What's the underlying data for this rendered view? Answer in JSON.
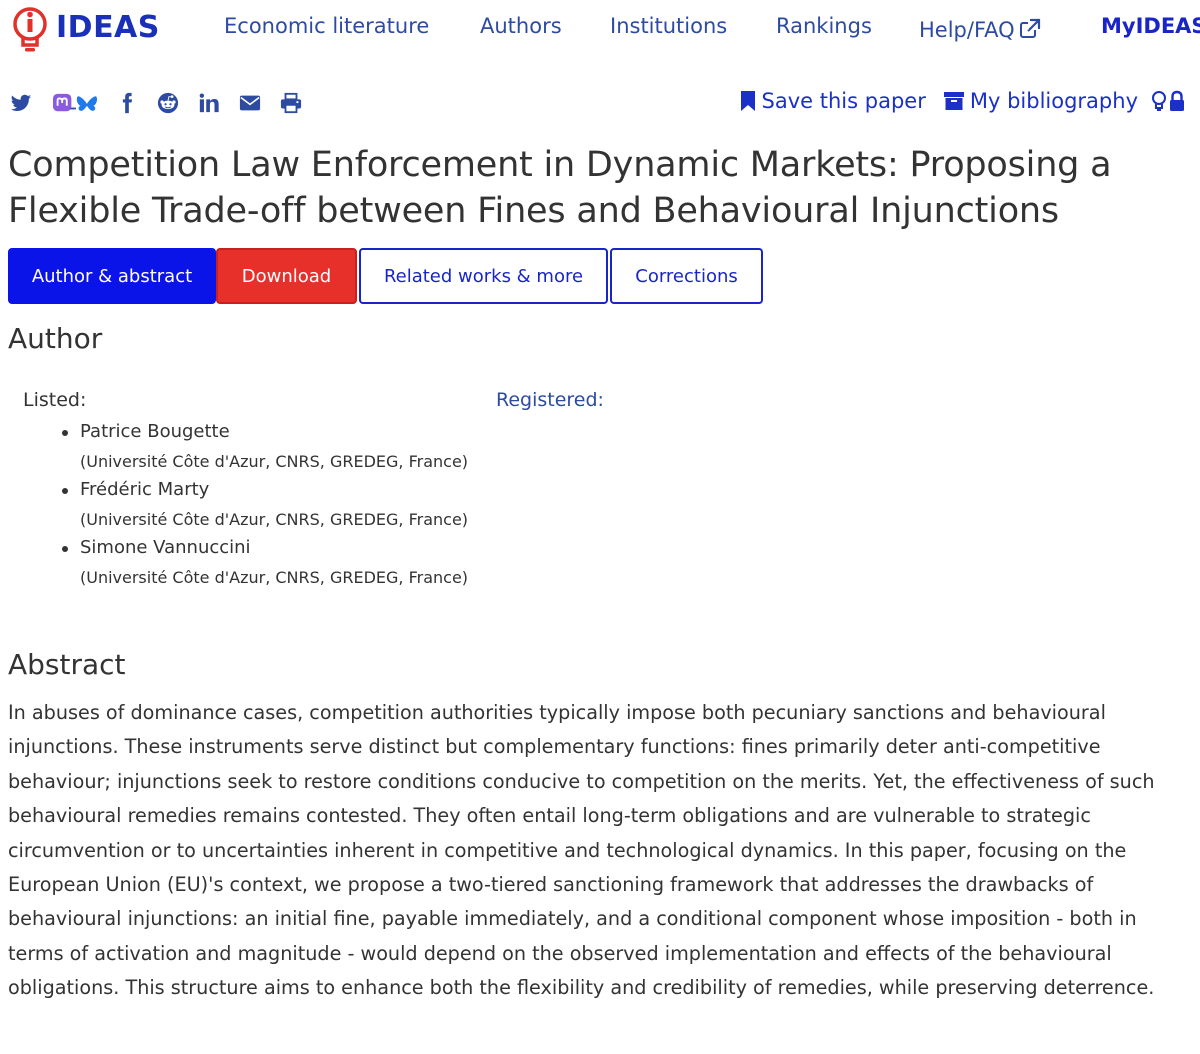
{
  "site": {
    "logo_text": "IDEAS"
  },
  "nav": {
    "econ": "Economic literature",
    "authors": "Authors",
    "institutions": "Institutions",
    "rankings": "Rankings",
    "help": "Help/FAQ",
    "myideas": "MyIDEAS"
  },
  "share_icons": [
    "twitter-icon",
    "mastodon-bluesky-icon",
    "facebook-icon",
    "reddit-icon",
    "linkedin-icon",
    "email-icon",
    "print-icon"
  ],
  "actions": {
    "save": "Save this paper",
    "bibliography": "My bibliography"
  },
  "paper": {
    "title": "Competition Law Enforcement in Dynamic Markets: Proposing a Flexible Trade-off between Fines and Behavioural Injunctions"
  },
  "tabs": {
    "author_abstract": "Author & abstract",
    "download": "Download",
    "related": "Related works & more",
    "corrections": "Corrections"
  },
  "author_section": {
    "heading": "Author",
    "listed_label": "Listed:",
    "registered_label": "Registered:",
    "authors": [
      {
        "name": "Patrice Bougette",
        "affiliation": "(Université Côte d'Azur, CNRS, GREDEG, France)"
      },
      {
        "name": "Frédéric Marty",
        "affiliation": "(Université Côte d'Azur, CNRS, GREDEG, France)"
      },
      {
        "name": "Simone Vannuccini",
        "affiliation": "(Université Côte d'Azur, CNRS, GREDEG, France)"
      }
    ]
  },
  "abstract_section": {
    "heading": "Abstract",
    "text": "In abuses of dominance cases, competition authorities typically impose both pecuniary sanctions and behavioural injunctions. These instruments serve distinct but complementary functions: fines primarily deter anti-competitive behaviour; injunctions seek to restore conditions conducive to competition on the merits. Yet, the effectiveness of such behavioural remedies remains contested. They often entail long-term obligations and are vulnerable to strategic circumvention or to uncertainties inherent in competitive and technological dynamics. In this paper, focusing on the European Union (EU)'s context, we propose a two-tiered sanctioning framework that addresses the drawbacks of behavioural injunctions: an initial fine, payable immediately, and a conditional component whose imposition - both in terms of activation and magnitude - would depend on the observed implementation and effects of the behavioural obligations. This structure aims to enhance both the flexibility and credibility of remedies, while preserving deterrence."
  },
  "colors": {
    "nav_link": "#2c4ba1",
    "brand": "#1a30b8",
    "accent_blue": "#0b14e8",
    "download_red": "#e8302a",
    "logo_red": "#e0312b"
  }
}
